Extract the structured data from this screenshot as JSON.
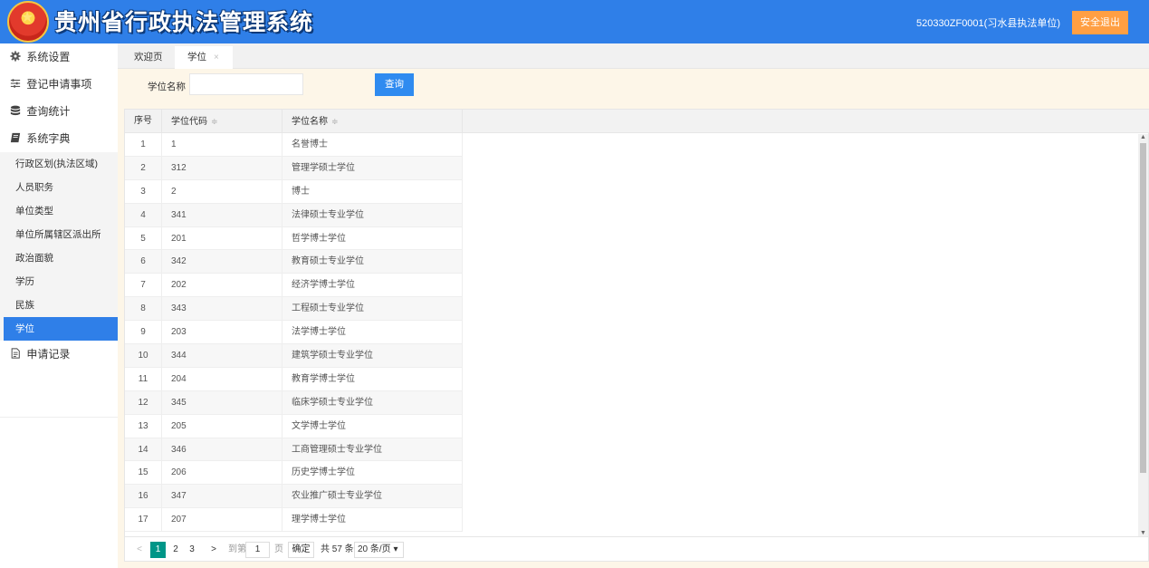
{
  "header": {
    "title": "贵州省行政执法管理系统",
    "user": "520330ZF0001(习水县执法单位)",
    "logout_label": "安全退出"
  },
  "sidebar": {
    "items": [
      {
        "label": "系统设置",
        "icon": "gear-icon"
      },
      {
        "label": "登记申请事项",
        "icon": "sliders-icon"
      },
      {
        "label": "查询统计",
        "icon": "database-icon"
      },
      {
        "label": "系统字典",
        "icon": "book-icon"
      }
    ],
    "sub_items": [
      "行政区划(执法区域)",
      "人员职务",
      "单位类型",
      "单位所属辖区派出所",
      "政治面貌",
      "学历",
      "民族",
      "学位"
    ],
    "last_item": {
      "label": "申请记录",
      "icon": "file-icon"
    }
  },
  "tabs": [
    {
      "label": "欢迎页"
    },
    {
      "label": "学位",
      "close": "×"
    }
  ],
  "search": {
    "label": "学位名称",
    "value": "",
    "button": "查询"
  },
  "table": {
    "headers": [
      "序号",
      "学位代码",
      "学位名称"
    ],
    "sort_glyph": "≑",
    "rows": [
      [
        "1",
        "1",
        "名誉博士"
      ],
      [
        "2",
        "312",
        "管理学硕士学位"
      ],
      [
        "3",
        "2",
        "博士"
      ],
      [
        "4",
        "341",
        "法律硕士专业学位"
      ],
      [
        "5",
        "201",
        "哲学博士学位"
      ],
      [
        "6",
        "342",
        "教育硕士专业学位"
      ],
      [
        "7",
        "202",
        "经济学博士学位"
      ],
      [
        "8",
        "343",
        "工程硕士专业学位"
      ],
      [
        "9",
        "203",
        "法学博士学位"
      ],
      [
        "10",
        "344",
        "建筑学硕士专业学位"
      ],
      [
        "11",
        "204",
        "教育学博士学位"
      ],
      [
        "12",
        "345",
        "临床学硕士专业学位"
      ],
      [
        "13",
        "205",
        "文学博士学位"
      ],
      [
        "14",
        "346",
        "工商管理硕士专业学位"
      ],
      [
        "15",
        "206",
        "历史学博士学位"
      ],
      [
        "16",
        "347",
        "农业推广硕士专业学位"
      ],
      [
        "17",
        "207",
        "理学博士学位"
      ]
    ]
  },
  "pager": {
    "prev": "<",
    "pages": [
      "1",
      "2",
      "3"
    ],
    "current": "1",
    "next": ">",
    "goto_label": "到第",
    "goto_value": "1",
    "page_unit": "页",
    "confirm": "确定",
    "total": "共 57 条",
    "page_size": "20 条/页 ▾"
  }
}
